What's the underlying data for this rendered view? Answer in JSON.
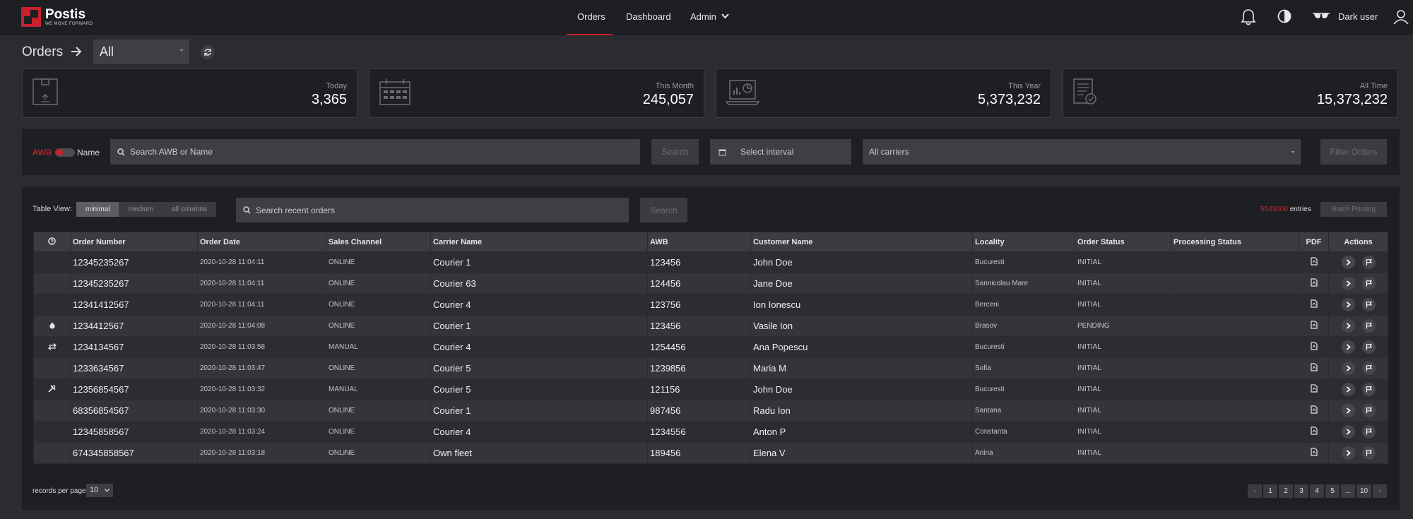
{
  "brand": {
    "name": "Postis",
    "tagline": "WE MOVE FORWARD"
  },
  "nav": {
    "links": [
      "Orders",
      "Dashboard",
      "Admin"
    ],
    "active": "Orders",
    "user_name": "Dark user"
  },
  "page": {
    "title": "Orders",
    "scope_value": "All"
  },
  "stats": [
    {
      "label": "Today",
      "value": "3,365",
      "icon": "box-icon"
    },
    {
      "label": "This Month",
      "value": "245,057",
      "icon": "calendar-icon"
    },
    {
      "label": "This Year",
      "value": "5,373,232",
      "icon": "laptop-chart-icon"
    },
    {
      "label": "All Time",
      "value": "15,373,232",
      "icon": "document-check-icon"
    }
  ],
  "filters": {
    "awb_label": "AWB",
    "name_label": "Name",
    "search_placeholder": "Search AWB or Name",
    "search_button": "Search",
    "interval_placeholder": "Select interval",
    "carriers_value": "All carriers",
    "filter_button": "Filter Orders"
  },
  "table_controls": {
    "view_label": "Table View:",
    "views": [
      "minimal",
      "medium",
      "all columns"
    ],
    "active_view": "minimal",
    "search_placeholder": "Search recent orders",
    "search_button": "Search",
    "entries_count": "5543606",
    "entries_label": "entries",
    "batch_button": "Batch Printing"
  },
  "table": {
    "columns": [
      "",
      "Order Number",
      "Order Date",
      "Sales Channel",
      "Carrier Name",
      "AWB",
      "Customer Name",
      "Locality",
      "Order Status",
      "Processing Status",
      "PDF",
      "Actions"
    ],
    "rows": [
      {
        "flag": "",
        "order": "12345235267",
        "date": "2020-10-28 11:04:11",
        "channel": "ONLINE",
        "carrier": "Courier 1",
        "awb": "123456",
        "customer": "John Doe",
        "locality": "Bucuresti",
        "status": "INITIAL",
        "processing": ""
      },
      {
        "flag": "",
        "order": "12345235267",
        "date": "2020-10-28 11:04:11",
        "channel": "ONLINE",
        "carrier": "Courier 63",
        "awb": "124456",
        "customer": "Jane Doe",
        "locality": "Sannicolau Mare",
        "status": "INITIAL",
        "processing": ""
      },
      {
        "flag": "",
        "order": "12341412567",
        "date": "2020-10-28 11:04:11",
        "channel": "ONLINE",
        "carrier": "Courier 4",
        "awb": "123756",
        "customer": "Ion Ionescu",
        "locality": "Berceni",
        "status": "INITIAL",
        "processing": ""
      },
      {
        "flag": "moneybag-icon",
        "order": "1234412567",
        "date": "2020-10-28 11:04:08",
        "channel": "ONLINE",
        "carrier": "Courier 1",
        "awb": "123456",
        "customer": "Vasile Ion",
        "locality": "Brasov",
        "status": "PENDING",
        "processing": ""
      },
      {
        "flag": "exchange-icon",
        "order": "1234134567",
        "date": "2020-10-28 11:03:58",
        "channel": "MANUAL",
        "carrier": "Courier 4",
        "awb": "1254456",
        "customer": "Ana Popescu",
        "locality": "Bucuresti",
        "status": "INITIAL",
        "processing": ""
      },
      {
        "flag": "",
        "order": "1233634567",
        "date": "2020-10-28 11:03:47",
        "channel": "ONLINE",
        "carrier": "Courier 5",
        "awb": "1239856",
        "customer": "Maria M",
        "locality": "Sofia",
        "status": "INITIAL",
        "processing": ""
      },
      {
        "flag": "tools-icon",
        "order": "12356854567",
        "date": "2020-10-28 11:03:32",
        "channel": "MANUAL",
        "carrier": "Courier 5",
        "awb": "121156",
        "customer": "John Doe",
        "locality": "Bucuresti",
        "status": "INITIAL",
        "processing": ""
      },
      {
        "flag": "",
        "order": "68356854567",
        "date": "2020-10-28 11:03:30",
        "channel": "ONLINE",
        "carrier": "Courier 1",
        "awb": "987456",
        "customer": "Radu Ion",
        "locality": "Santana",
        "status": "INITIAL",
        "processing": ""
      },
      {
        "flag": "",
        "order": "12345858567",
        "date": "2020-10-28 11:03:24",
        "channel": "ONLINE",
        "carrier": "Courier 4",
        "awb": "1234556",
        "customer": "Anton P",
        "locality": "Constanta",
        "status": "INITIAL",
        "processing": ""
      },
      {
        "flag": "",
        "order": "674345858567",
        "date": "2020-10-28 11:03:18",
        "channel": "ONLINE",
        "carrier": "Own fleet",
        "awb": "189456",
        "customer": "Elena V",
        "locality": "Anina",
        "status": "INITIAL",
        "processing": ""
      }
    ]
  },
  "footer": {
    "rpp_label": "records per page",
    "rpp_value": "10",
    "pages": [
      "‹",
      "1",
      "2",
      "3",
      "4",
      "5",
      "...",
      "10",
      "›"
    ]
  },
  "colors": {
    "accent": "#c8202c",
    "background": "#2a2c31",
    "panel": "#1e1f23"
  }
}
